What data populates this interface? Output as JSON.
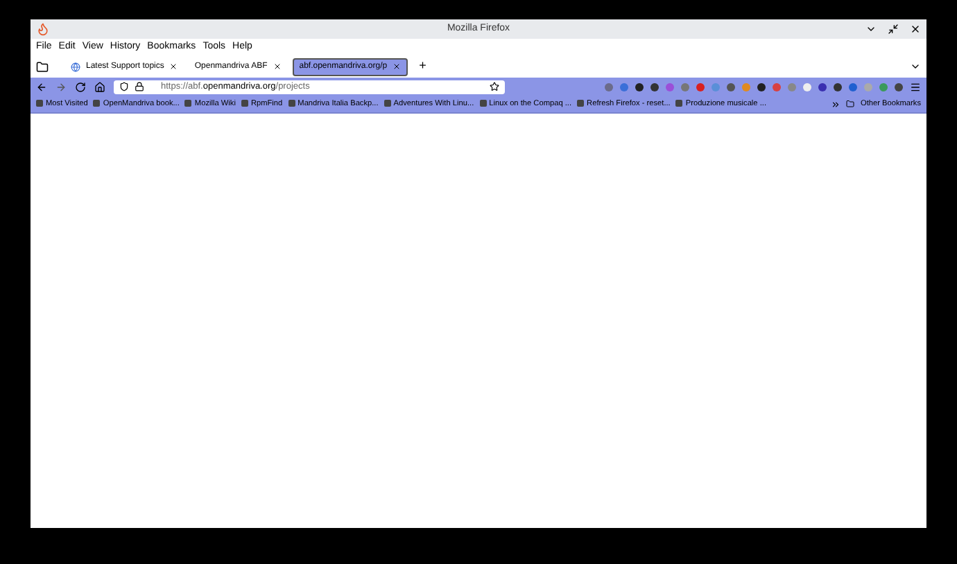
{
  "window": {
    "title": "Mozilla Firefox"
  },
  "menu": [
    "File",
    "Edit",
    "View",
    "History",
    "Bookmarks",
    "Tools",
    "Help"
  ],
  "tabs": [
    {
      "label": "Latest Support topics",
      "selected": false
    },
    {
      "label": "Openmandriva ABF",
      "selected": false
    },
    {
      "label": "abf.openmandriva.org/p",
      "selected": true
    }
  ],
  "new_tab": "+",
  "url": {
    "prefix": "https://abf.",
    "domain": "openmandriva.org",
    "path": "/projects"
  },
  "bookmarks": [
    "Most Visited",
    "OpenMandriva book...",
    "Mozilla Wiki",
    "RpmFind",
    "Mandriva Italia Backp...",
    "Adventures With Linu...",
    "Linux on the Compaq ...",
    "Refresh Firefox - reset...",
    "Produzione musicale ..."
  ],
  "other_bookmarks": "Other Bookmarks"
}
